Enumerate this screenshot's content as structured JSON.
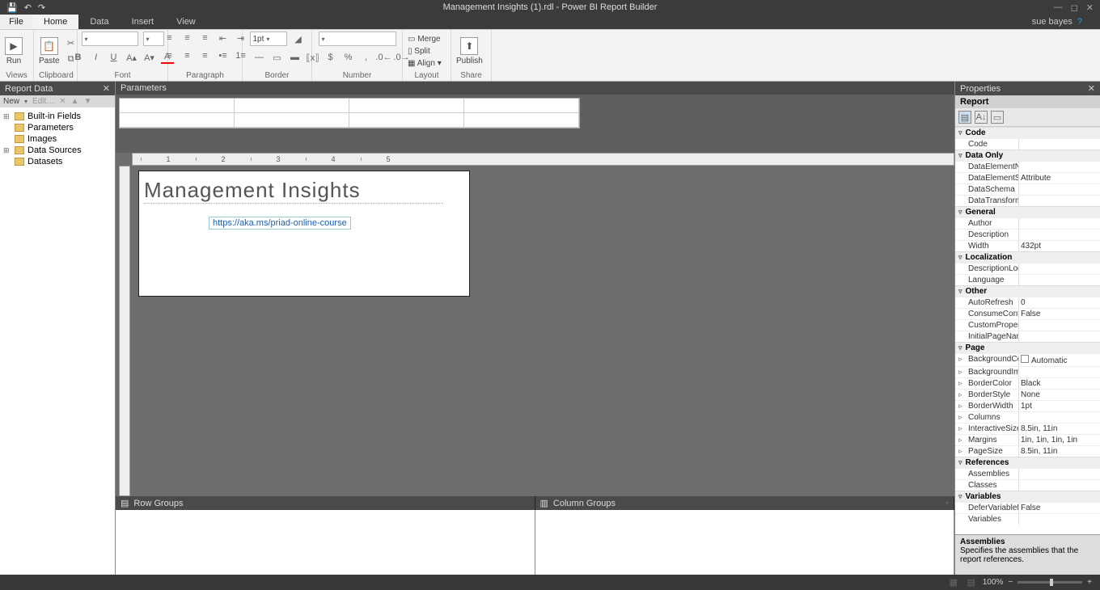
{
  "titlebar": {
    "title": "Management Insights (1).rdl - Power BI Report Builder"
  },
  "user": {
    "name": "sue bayes"
  },
  "menu": {
    "file": "File",
    "tabs": [
      "Home",
      "Data",
      "Insert",
      "View"
    ],
    "active": 0
  },
  "ribbon": {
    "views": {
      "run": "Run",
      "label": "Views"
    },
    "clipboard": {
      "paste": "Paste",
      "label": "Clipboard"
    },
    "font": {
      "label": "Font"
    },
    "paragraph": {
      "label": "Paragraph"
    },
    "border": {
      "width": "1pt",
      "label": "Border"
    },
    "number": {
      "label": "Number"
    },
    "layout": {
      "merge": "Merge",
      "split": "Split",
      "align": "Align",
      "label": "Layout"
    },
    "share": {
      "publish": "Publish",
      "label": "Share"
    }
  },
  "reportdata": {
    "title": "Report Data",
    "new": "New",
    "edit": "Edit…",
    "items": [
      "Built-in Fields",
      "Parameters",
      "Images",
      "Data Sources",
      "Datasets"
    ]
  },
  "parameters": {
    "title": "Parameters"
  },
  "report": {
    "title": "Management Insights",
    "link": "https://aka.ms/priad-online-course"
  },
  "groups": {
    "row": "Row Groups",
    "col": "Column Groups"
  },
  "properties": {
    "title": "Properties",
    "object": "Report",
    "cats": {
      "Code": [
        {
          "k": "Code",
          "v": ""
        }
      ],
      "Data Only": [
        {
          "k": "DataElementNam",
          "v": ""
        },
        {
          "k": "DataElementStyle",
          "v": "Attribute"
        },
        {
          "k": "DataSchema",
          "v": ""
        },
        {
          "k": "DataTransform",
          "v": ""
        }
      ],
      "General": [
        {
          "k": "Author",
          "v": ""
        },
        {
          "k": "Description",
          "v": ""
        },
        {
          "k": "Width",
          "v": "432pt"
        }
      ],
      "Localization": [
        {
          "k": "DescriptionLocID",
          "v": ""
        },
        {
          "k": "Language",
          "v": ""
        }
      ],
      "Other": [
        {
          "k": "AutoRefresh",
          "v": "0"
        },
        {
          "k": "ConsumeContain",
          "v": "False"
        },
        {
          "k": "CustomPropertie",
          "v": ""
        },
        {
          "k": "InitialPageName",
          "v": ""
        }
      ],
      "Page": [
        {
          "k": "BackgroundColor",
          "v": "Automatic",
          "swatch": true,
          "expand": true
        },
        {
          "k": "BackgroundImag",
          "v": "",
          "expand": true
        },
        {
          "k": "BorderColor",
          "v": "Black",
          "expand": true
        },
        {
          "k": "BorderStyle",
          "v": "None",
          "expand": true
        },
        {
          "k": "BorderWidth",
          "v": "1pt",
          "expand": true
        },
        {
          "k": "Columns",
          "v": "",
          "expand": true
        },
        {
          "k": "InteractiveSize",
          "v": "8.5in, 11in",
          "expand": true
        },
        {
          "k": "Margins",
          "v": "1in, 1in, 1in, 1in",
          "expand": true
        },
        {
          "k": "PageSize",
          "v": "8.5in, 11in",
          "expand": true
        }
      ],
      "References": [
        {
          "k": "Assemblies",
          "v": ""
        },
        {
          "k": "Classes",
          "v": ""
        }
      ],
      "Variables": [
        {
          "k": "DeferVariableEval",
          "v": "False"
        },
        {
          "k": "Variables",
          "v": ""
        }
      ]
    },
    "desc": {
      "name": "Assemblies",
      "text": "Specifies the assemblies that the report references."
    }
  },
  "status": {
    "zoom": "100%"
  },
  "ruler": [
    "1",
    "2",
    "3",
    "4",
    "5"
  ]
}
